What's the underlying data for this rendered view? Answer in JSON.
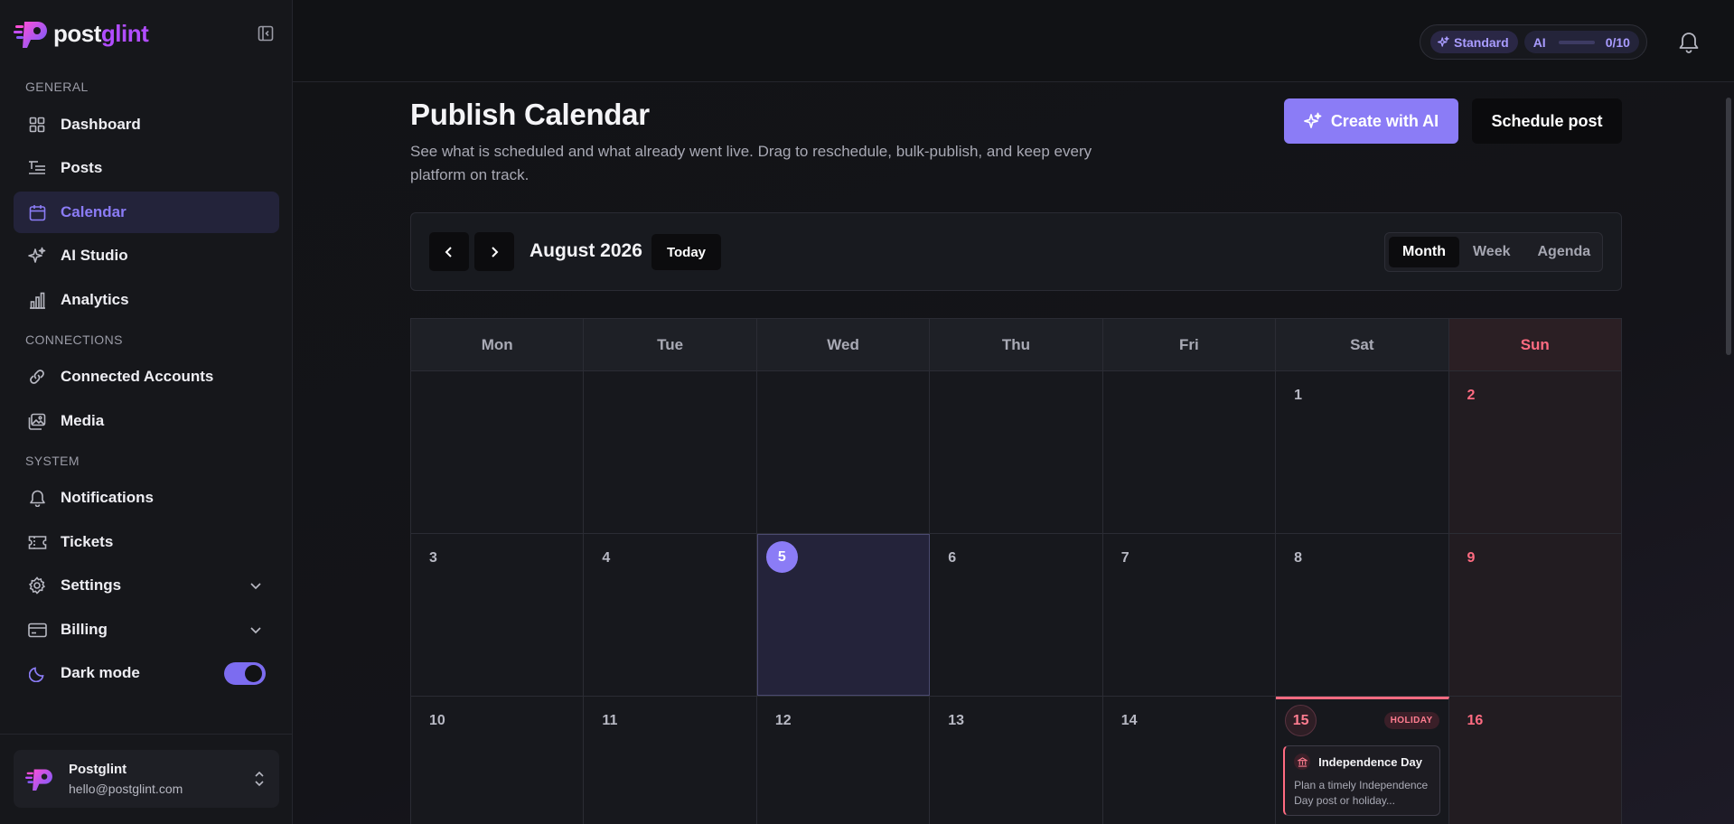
{
  "brand": {
    "name_part1": "post",
    "name_part2": "glint",
    "accent": "#8b7cf6"
  },
  "sidebar": {
    "sections": [
      {
        "label": "GENERAL"
      },
      {
        "label": "CONNECTIONS"
      },
      {
        "label": "SYSTEM"
      }
    ],
    "items": [
      {
        "label": "Dashboard",
        "icon": "dashboard-icon"
      },
      {
        "label": "Posts",
        "icon": "posts-icon"
      },
      {
        "label": "Calendar",
        "icon": "calendar-icon",
        "active": true
      },
      {
        "label": "AI Studio",
        "icon": "sparkle-icon"
      },
      {
        "label": "Analytics",
        "icon": "bar-chart-icon"
      },
      {
        "label": "Connected Accounts",
        "icon": "link-icon"
      },
      {
        "label": "Media",
        "icon": "image-icon"
      },
      {
        "label": "Notifications",
        "icon": "bell-icon"
      },
      {
        "label": "Tickets",
        "icon": "ticket-icon"
      },
      {
        "label": "Settings",
        "icon": "gear-icon"
      },
      {
        "label": "Billing",
        "icon": "card-icon"
      },
      {
        "label": "Dark mode",
        "icon": "moon-icon"
      }
    ],
    "dark_mode_on": true,
    "user": {
      "name": "Postglint",
      "email": "hello@postglint.com"
    }
  },
  "topbar": {
    "plan_label": "Standard",
    "ai_label": "AI",
    "ai_usage": "0/10",
    "ai_usage_value": 0
  },
  "page": {
    "title": "Publish Calendar",
    "description": "See what is scheduled and what already went live. Drag to reschedule, bulk-publish, and keep every platform on track.",
    "create_ai_label": "Create with AI",
    "schedule_label": "Schedule post"
  },
  "calendar": {
    "month_label": "August 2026",
    "today_label": "Today",
    "views": [
      "Month",
      "Week",
      "Agenda"
    ],
    "active_view": "Month",
    "weekdays": [
      "Mon",
      "Tue",
      "Wed",
      "Thu",
      "Fri",
      "Sat",
      "Sun"
    ],
    "weeks": [
      [
        "",
        "",
        "",
        "",
        "",
        "1",
        "2"
      ],
      [
        "3",
        "4",
        "5",
        "6",
        "7",
        "8",
        "9"
      ],
      [
        "10",
        "11",
        "12",
        "13",
        "14",
        "15",
        "16"
      ]
    ],
    "today": "5",
    "holiday": {
      "day": "15",
      "badge": "HOLIDAY",
      "title": "Independence Day",
      "description": "Plan a timely Independence Day post or holiday..."
    }
  }
}
